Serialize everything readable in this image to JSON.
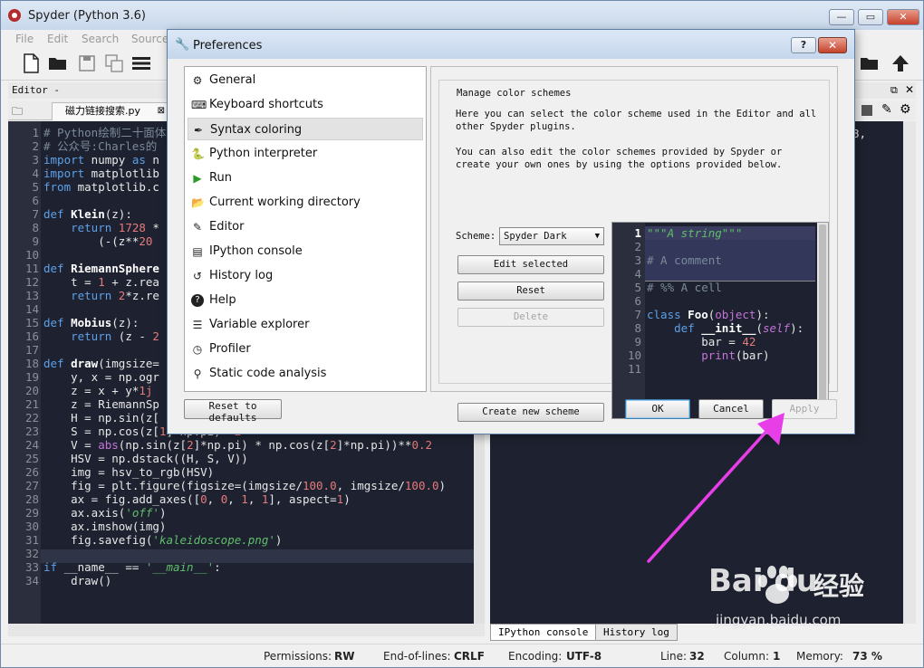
{
  "window": {
    "title": "Spyder (Python 3.6)",
    "minimize": "—",
    "maximize": "▭",
    "close": "✕"
  },
  "menu": [
    "File",
    "Edit",
    "Search",
    "Source"
  ],
  "editor": {
    "path_label": "Editor - C:\\Users\\Administra",
    "tab_label": "磁力链接搜索.py",
    "lines": [
      {
        "n": "1",
        "html": "<span class='cm'># Python绘制二十面体</span>"
      },
      {
        "n": "2",
        "html": "<span class='cm'># 公众号:Charles的</span>"
      },
      {
        "n": "3",
        "html": "<span class='kw'>import</span> numpy <span class='kw'>as</span> n"
      },
      {
        "n": "4",
        "html": "<span class='kw'>import</span> matplotlib"
      },
      {
        "n": "5",
        "html": "<span class='kw'>from</span> matplotlib.c"
      },
      {
        "n": "6",
        "html": ""
      },
      {
        "n": "7",
        "html": "<span class='kw'>def</span> <span class='fn'>Klein</span>(z):"
      },
      {
        "n": "8",
        "html": "    <span class='kw'>return</span> <span class='nm'>1728</span> *"
      },
      {
        "n": "9",
        "html": "        (-(z**<span class='nm'>20</span>"
      },
      {
        "n": "10",
        "html": ""
      },
      {
        "n": "11",
        "html": "<span class='kw'>def</span> <span class='fn'>RiemannSphere</span>"
      },
      {
        "n": "12",
        "html": "    t = <span class='nm'>1</span> + z.rea"
      },
      {
        "n": "13",
        "html": "    <span class='kw'>return</span> <span class='nm'>2</span>*z.re"
      },
      {
        "n": "14",
        "html": ""
      },
      {
        "n": "15",
        "html": "<span class='kw'>def</span> <span class='fn'>Mobius</span>(z):"
      },
      {
        "n": "16",
        "html": "    <span class='kw'>return</span> (z - <span class='nm'>2</span>"
      },
      {
        "n": "17",
        "html": ""
      },
      {
        "n": "18",
        "html": "<span class='kw'>def</span> <span class='fn'>draw</span>(imgsize="
      },
      {
        "n": "19",
        "html": "    y, x = np.ogr"
      },
      {
        "n": "20",
        "html": "    z = x + y*<span class='nm'>1j</span>"
      },
      {
        "n": "21",
        "html": "    z = RiemannSp"
      },
      {
        "n": "22",
        "html": "    H = np.sin(z["
      },
      {
        "n": "23",
        "html": "    S = np.cos(z[<span class='nm'>1</span>]*np.pi)**<span class='nm'>2</span>"
      },
      {
        "n": "24",
        "html": "    V = <span class='bi'>abs</span>(np.sin(z[<span class='nm'>2</span>]*np.pi) * np.cos(z[<span class='nm'>2</span>]*np.pi))**<span class='nm'>0.2</span>"
      },
      {
        "n": "25",
        "html": "    HSV = np.dstack((H, S, V))"
      },
      {
        "n": "26",
        "html": "    img = hsv_to_rgb(HSV)"
      },
      {
        "n": "27",
        "html": "    fig = plt.figure(figsize=(imgsize/<span class='nm'>100.0</span>, imgsize/<span class='nm'>100.0</span>)"
      },
      {
        "n": "28",
        "html": "    ax = fig.add_axes([<span class='nm'>0</span>, <span class='nm'>0</span>, <span class='nm'>1</span>, <span class='nm'>1</span>], aspect=<span class='nm'>1</span>)"
      },
      {
        "n": "29",
        "html": "    ax.axis(<span class='st'>'off'</span>)"
      },
      {
        "n": "30",
        "html": "    ax.imshow(img)"
      },
      {
        "n": "31",
        "html": "    fig.savefig(<span class='st'>'kaleidoscope.png'</span>)"
      },
      {
        "n": "32",
        "html": ""
      },
      {
        "n": "33",
        "html": "<span class='kw'>if</span> __name__ == <span class='st'>'__main__'</span>:"
      },
      {
        "n": "34",
        "html": "    draw()"
      }
    ]
  },
  "console": {
    "text": "8,",
    "tabs": [
      "IPython console",
      "History log"
    ]
  },
  "status": {
    "permissions_label": "Permissions:",
    "permissions_value": "RW",
    "eol_label": "End-of-lines:",
    "eol_value": "CRLF",
    "encoding_label": "Encoding:",
    "encoding_value": "UTF-8",
    "line_label": "Line:",
    "line_value": "32",
    "column_label": "Column:",
    "column_value": "1",
    "memory_label": "Memory:",
    "memory_value": "73 %"
  },
  "dialog": {
    "title": "Preferences",
    "help": "?",
    "close": "✕",
    "categories": [
      {
        "label": "General",
        "icon": "gears-icon"
      },
      {
        "label": "Keyboard shortcuts",
        "icon": "keyboard-icon"
      },
      {
        "label": "Syntax coloring",
        "icon": "eyedropper-icon"
      },
      {
        "label": "Python interpreter",
        "icon": "python-icon"
      },
      {
        "label": "Run",
        "icon": "play-icon"
      },
      {
        "label": "Current working directory",
        "icon": "folder-icon"
      },
      {
        "label": "Editor",
        "icon": "edit-icon"
      },
      {
        "label": "IPython console",
        "icon": "ipython-icon"
      },
      {
        "label": "History log",
        "icon": "history-icon"
      },
      {
        "label": "Help",
        "icon": "help-icon"
      },
      {
        "label": "Variable explorer",
        "icon": "list-icon"
      },
      {
        "label": "Profiler",
        "icon": "clock-icon"
      },
      {
        "label": "Static code analysis",
        "icon": "magnifier-icon"
      }
    ],
    "selected_category": 2,
    "reset_defaults": "Reset to defaults",
    "group_title": "Manage color schemes",
    "desc1": "Here you can select the color scheme used in the Editor and all other Spyder plugins.",
    "desc2": "You can also edit the color schemes provided by Spyder or create your own ones by using the options provided below.",
    "scheme_label": "Scheme:",
    "scheme_value": "Spyder Dark",
    "edit_selected": "Edit selected",
    "reset": "Reset",
    "delete": "Delete",
    "create_new": "Create new scheme",
    "preview_lines": [
      {
        "n": "1",
        "html": "<span class='st'>\"\"\"A string\"\"\"</span>"
      },
      {
        "n": "2",
        "html": ""
      },
      {
        "n": "3",
        "html": "<span class='cm'># A comment</span>"
      },
      {
        "n": "4",
        "html": ""
      },
      {
        "n": "5",
        "html": "<span class='cm'># %% A cell</span>"
      },
      {
        "n": "6",
        "html": ""
      },
      {
        "n": "7",
        "html": "<span class='kw'>class</span> <span class='fn'>Foo</span>(<span class='bi'>object</span>):"
      },
      {
        "n": "8",
        "html": "    <span class='kw'>def</span> <span class='fn'>__init__</span>(<span class='bi' style='font-style:italic'>self</span>):"
      },
      {
        "n": "9",
        "html": "        bar = <span class='nm'>42</span>"
      },
      {
        "n": "10",
        "html": "        <span class='bi'>print</span>(bar)"
      },
      {
        "n": "11",
        "html": ""
      }
    ],
    "ok": "OK",
    "cancel": "Cancel",
    "apply": "Apply"
  },
  "watermark": {
    "logo": "Bai du",
    "cn": "经验",
    "url": "jingyan.baidu.com"
  },
  "colors": {
    "editor_bg": "#1e2230",
    "annotation_arrow": "#e83ee8"
  }
}
